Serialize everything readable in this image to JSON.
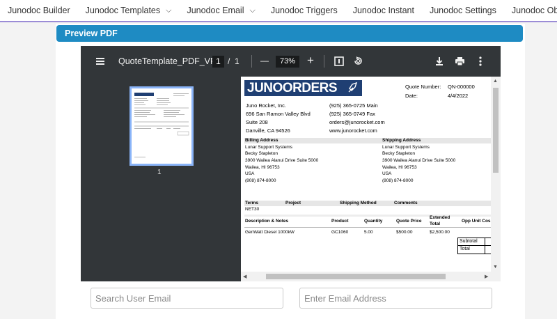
{
  "nav": {
    "items": [
      {
        "label": "Junodoc Builder",
        "chev": ""
      },
      {
        "label": "Junodoc Templates",
        "chev": "⌵"
      },
      {
        "label": "Junodoc Email",
        "chev": "⌵"
      },
      {
        "label": "Junodoc Triggers",
        "chev": ""
      },
      {
        "label": "Junodoc Instant",
        "chev": ""
      },
      {
        "label": "Junodoc Settings",
        "chev": ""
      },
      {
        "label": "Junodoc Object Settings",
        "chev": ""
      }
    ],
    "more": "* /"
  },
  "card": {
    "title": "Preview PDF"
  },
  "viewer": {
    "filename": "QuoteTemplate_PDF_VF",
    "page_current": "1",
    "page_sep": "/",
    "page_total": "1",
    "zoom": "73%",
    "minus": "—",
    "plus": "+",
    "thumb_label": "1"
  },
  "doc": {
    "logo": "JUNOORDERS",
    "quote_number_label": "Quote Number:",
    "quote_number": "QN-000000",
    "date_label": "Date:",
    "date": "4/4/2022",
    "company": [
      "Juno Rocket, Inc.",
      "696 San Ramon Valley Blvd",
      "Suite 208",
      "Danville, CA 94526"
    ],
    "contact": [
      "(925) 365-0725 Main",
      "(925) 365-0749 Fax",
      "orders@junorocket.com",
      "www.junorocket.com"
    ],
    "billing_title": "Billing Address",
    "billing": [
      "Lunar Support Systems",
      "Becky Stapleton",
      "3900 Wailea Alanui Drive Suite 5000",
      "Wailea, HI 96753",
      "USA",
      "(808) 874-8000"
    ],
    "shipping_title": "Shipping Address",
    "shipping": [
      "Lunar Support Systems",
      "Becky Stapleton",
      "3900 Wailea Alanui Drive Suite 5000",
      "Wailea, HI 96753",
      "USA",
      "(808) 874-8000"
    ],
    "terms_headers": [
      "Terms",
      "Project",
      "Shipping Method",
      "Comments"
    ],
    "terms_value": "NET30",
    "line_headers": [
      "Description & Notes",
      "Product",
      "Quantity",
      "Quote Price",
      "Extended",
      "Total",
      "Opp Unit Cos"
    ],
    "line_row": [
      "GenWatt Diesel 1000kW",
      "GC1060",
      "5.00",
      "$500.00",
      "$2,500.00"
    ],
    "subtotal_label": "Subtotal",
    "total_label": "Total"
  },
  "form": {
    "search_placeholder": "Search User Email",
    "email_placeholder": "Enter Email Address"
  },
  "colors": {
    "header": "#1e8bc3",
    "toolbar": "#323639",
    "logo": "#1f3f73"
  }
}
